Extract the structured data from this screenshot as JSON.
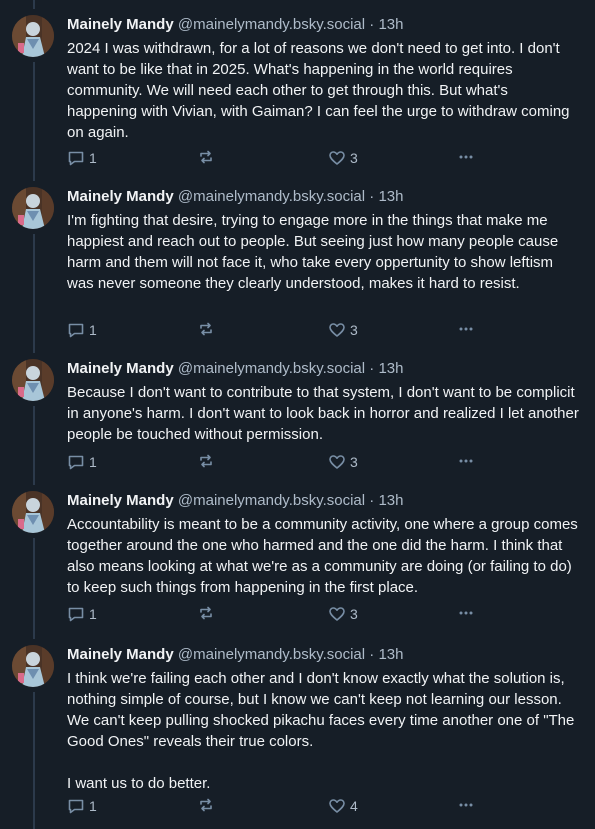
{
  "colors": {
    "background": "#161e27",
    "thread_line": "#2c3a4b",
    "text": "#f1f3f5",
    "muted": "#aebbc9",
    "icon": "#788ea5"
  },
  "posts": [
    {
      "author": {
        "display_name": "Mainely Mandy",
        "handle": "@mainelymandy.bsky.social"
      },
      "separator": "·",
      "time": "13h",
      "text": "2024 I was withdrawn, for a lot of reasons we don't need to get into. I don't want to be like that in 2025. What's happening in the world requires community. We will need each other to get through this. But what's happening with Vivian, with Gaiman? I can feel the urge to withdraw coming on again.",
      "replies": "1",
      "likes": "3"
    },
    {
      "author": {
        "display_name": "Mainely Mandy",
        "handle": "@mainelymandy.bsky.social"
      },
      "separator": "·",
      "time": "13h",
      "text": "I'm fighting that desire, trying to engage more in the things that make me happiest and reach out to people. But seeing just how many people cause harm and them will not face it, who take every oppertunity to show leftism was never someone they clearly understood, makes it hard to resist.",
      "replies": "1",
      "likes": "3"
    },
    {
      "author": {
        "display_name": "Mainely Mandy",
        "handle": "@mainelymandy.bsky.social"
      },
      "separator": "·",
      "time": "13h",
      "text": "Because I don't want to contribute to that system, I don't want to be complicit in anyone's harm. I don't want to look back in horror and realized I let another people be touched without permission.",
      "replies": "1",
      "likes": "3"
    },
    {
      "author": {
        "display_name": "Mainely Mandy",
        "handle": "@mainelymandy.bsky.social"
      },
      "separator": "·",
      "time": "13h",
      "text": "Accountability is meant to be a community activity, one where a group comes together around the one who harmed and the one did the harm. I think that also means looking at what we're as a community are doing (or failing to do) to keep such things from happening in the first place.",
      "replies": "1",
      "likes": "3"
    },
    {
      "author": {
        "display_name": "Mainely Mandy",
        "handle": "@mainelymandy.bsky.social"
      },
      "separator": "·",
      "time": "13h",
      "text": "I think we're failing each other and I don't know exactly what the solution is, nothing simple of course, but I know we can't keep not learning our lesson. We can't keep pulling shocked pikachu faces every time another one of \"The Good Ones\" reveals their true colors.\n\nI want us to do better.",
      "replies": "1",
      "likes": "4"
    }
  ],
  "icons": {
    "avatar": "profile-photo",
    "reply": "speech-bubble-icon",
    "repost": "repost-arrows-icon",
    "like": "heart-outline-icon",
    "more": "ellipsis-icon"
  }
}
